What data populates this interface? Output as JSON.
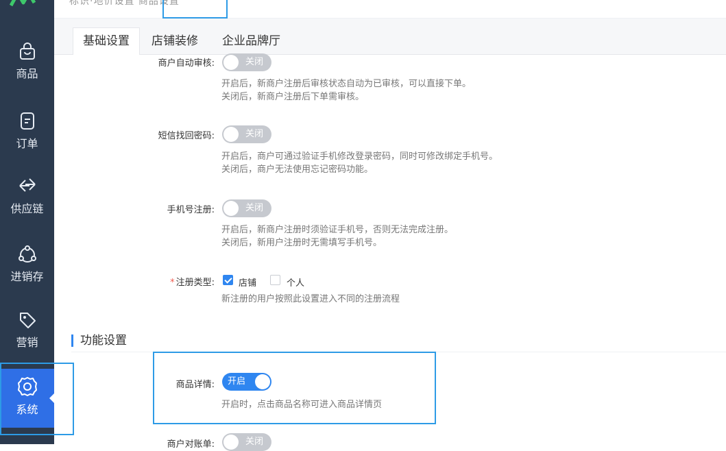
{
  "topbar": {
    "text": "标识·地价设置 商品设置"
  },
  "sidebar": {
    "items": [
      {
        "label": "商品",
        "icon": "shopping-bag-icon"
      },
      {
        "label": "订单",
        "icon": "order-doc-icon"
      },
      {
        "label": "供应链",
        "icon": "exchange-arrows-icon"
      },
      {
        "label": "进销存",
        "icon": "inventory-cycle-icon"
      },
      {
        "label": "营销",
        "icon": "tag-icon"
      },
      {
        "label": "系统",
        "icon": "gear-icon",
        "active": true
      }
    ]
  },
  "tabs": [
    {
      "label": "基础设置",
      "active": true
    },
    {
      "label": "店铺装修"
    },
    {
      "label": "企业品牌厅"
    }
  ],
  "settings": {
    "auto_audit": {
      "label": "商户自动审核:",
      "switch_text": "关闭",
      "on": false,
      "desc1": "开启后，新商户注册后审核状态自动为已审核，可以直接下单。",
      "desc2": "关闭后，新商户注册后下单需审核。"
    },
    "sms_password": {
      "label": "短信找回密码:",
      "switch_text": "关闭",
      "on": false,
      "desc1": "开启后，商户可通过验证手机修改登录密码，同时可修改绑定手机号。",
      "desc2": "关闭后，商户无法使用忘记密码功能。"
    },
    "phone_register": {
      "label": "手机号注册:",
      "switch_text": "关闭",
      "on": false,
      "desc1": "开启后，新商户注册时须验证手机号，否则无法完成注册。",
      "desc2": "关闭后，新用户注册时无需填写手机号。"
    },
    "register_type": {
      "required_mark": "*",
      "label": "注册类型:",
      "options": [
        {
          "label": "店铺",
          "checked": true
        },
        {
          "label": "个人",
          "checked": false
        }
      ],
      "desc": "新注册的用户按照此设置进入不同的注册流程"
    }
  },
  "feature_section": {
    "title": "功能设置",
    "product_detail": {
      "label": "商品详情:",
      "switch_text": "开启",
      "on": true,
      "desc": "开启时，点击商品名称可进入商品详情页"
    },
    "merchant_statement": {
      "label": "商户对账单:",
      "switch_text": "关闭",
      "on": false
    }
  },
  "colors": {
    "sidebar_bg": "#2b3a4e",
    "active_blue": "#2f6fe6",
    "switch_on": "#2f86f0",
    "switch_off": "#c6c9cf",
    "highlight_border": "#2d9be6"
  }
}
